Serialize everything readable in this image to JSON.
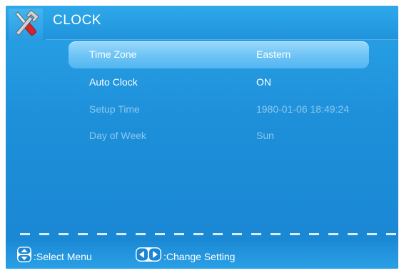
{
  "header": {
    "title": "CLOCK",
    "icon": "tools-icon"
  },
  "menu": {
    "items": [
      {
        "label": "Time Zone",
        "value": "Eastern",
        "state": "selected"
      },
      {
        "label": "Auto Clock",
        "value": "ON",
        "state": "enabled"
      },
      {
        "label": "Setup Time",
        "value": "1980-01-06 18:49:24",
        "state": "disabled"
      },
      {
        "label": "Day of Week",
        "value": "Sun",
        "state": "disabled"
      }
    ]
  },
  "footer": {
    "select_hint": ":Select Menu",
    "change_hint": ":Change Setting",
    "select_icon": "up-down-arrows-icon",
    "change_icon": "left-right-arrows-icon"
  },
  "colors": {
    "background": "#1d8fd9",
    "highlight": "#6cc3f5",
    "text": "#ffffff",
    "disabled_text": "#8cc8ee"
  }
}
